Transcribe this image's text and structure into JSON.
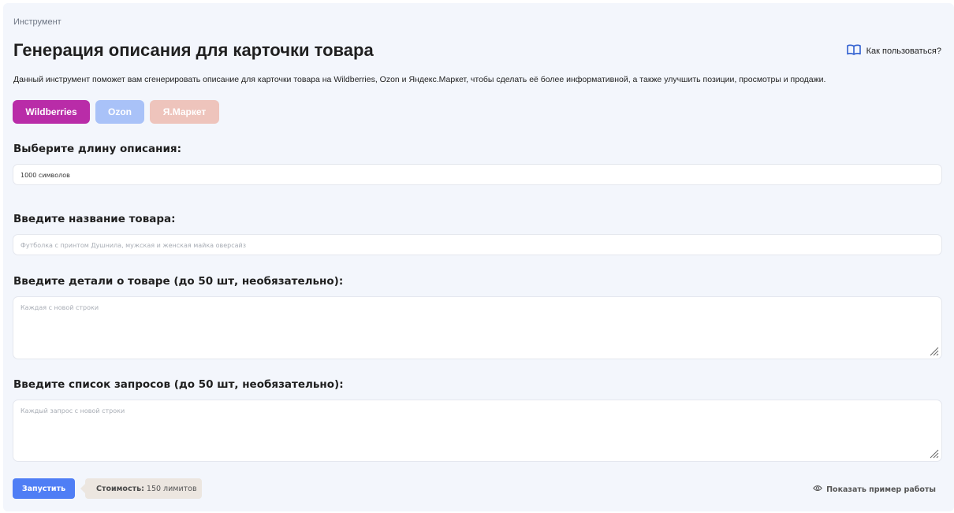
{
  "breadcrumb": "Инструмент",
  "title": "Генерация описания для карточки товара",
  "help_link": "Как пользоваться?",
  "description": "Данный инструмент поможет вам сгенерировать описание для карточки товара на Wildberries, Ozon и Яндекс.Маркет, чтобы сделать её более информативной, а также улучшить позиции, просмотры и продажи.",
  "marketplaces": [
    {
      "label": "Wildberries",
      "color": "#b92ca8",
      "selected": true
    },
    {
      "label": "Ozon",
      "color": "#a9c2f8",
      "selected": false
    },
    {
      "label": "Я.Маркет",
      "color": "#eec4bc",
      "selected": false
    }
  ],
  "length": {
    "label": "Выберите длину описания:",
    "value": "1000 символов"
  },
  "product_name": {
    "label": "Введите название товара:",
    "placeholder": "Футболка с принтом Душнила, мужская и женская майка оверсайз"
  },
  "details": {
    "label": "Введите детали о товаре (до 50 шт, необязательно):",
    "placeholder": "Каждая с новой строки"
  },
  "queries": {
    "label": "Введите список запросов (до 50 шт, необязательно):",
    "placeholder": "Каждый запрос с новой строки"
  },
  "run_button": "Запустить",
  "cost": {
    "label": "Стоимость:",
    "value": "150 лимитов"
  },
  "example_link": "Показать пример работы",
  "colors": {
    "accent": "#4f7ef5",
    "background": "#f3f6fc"
  }
}
